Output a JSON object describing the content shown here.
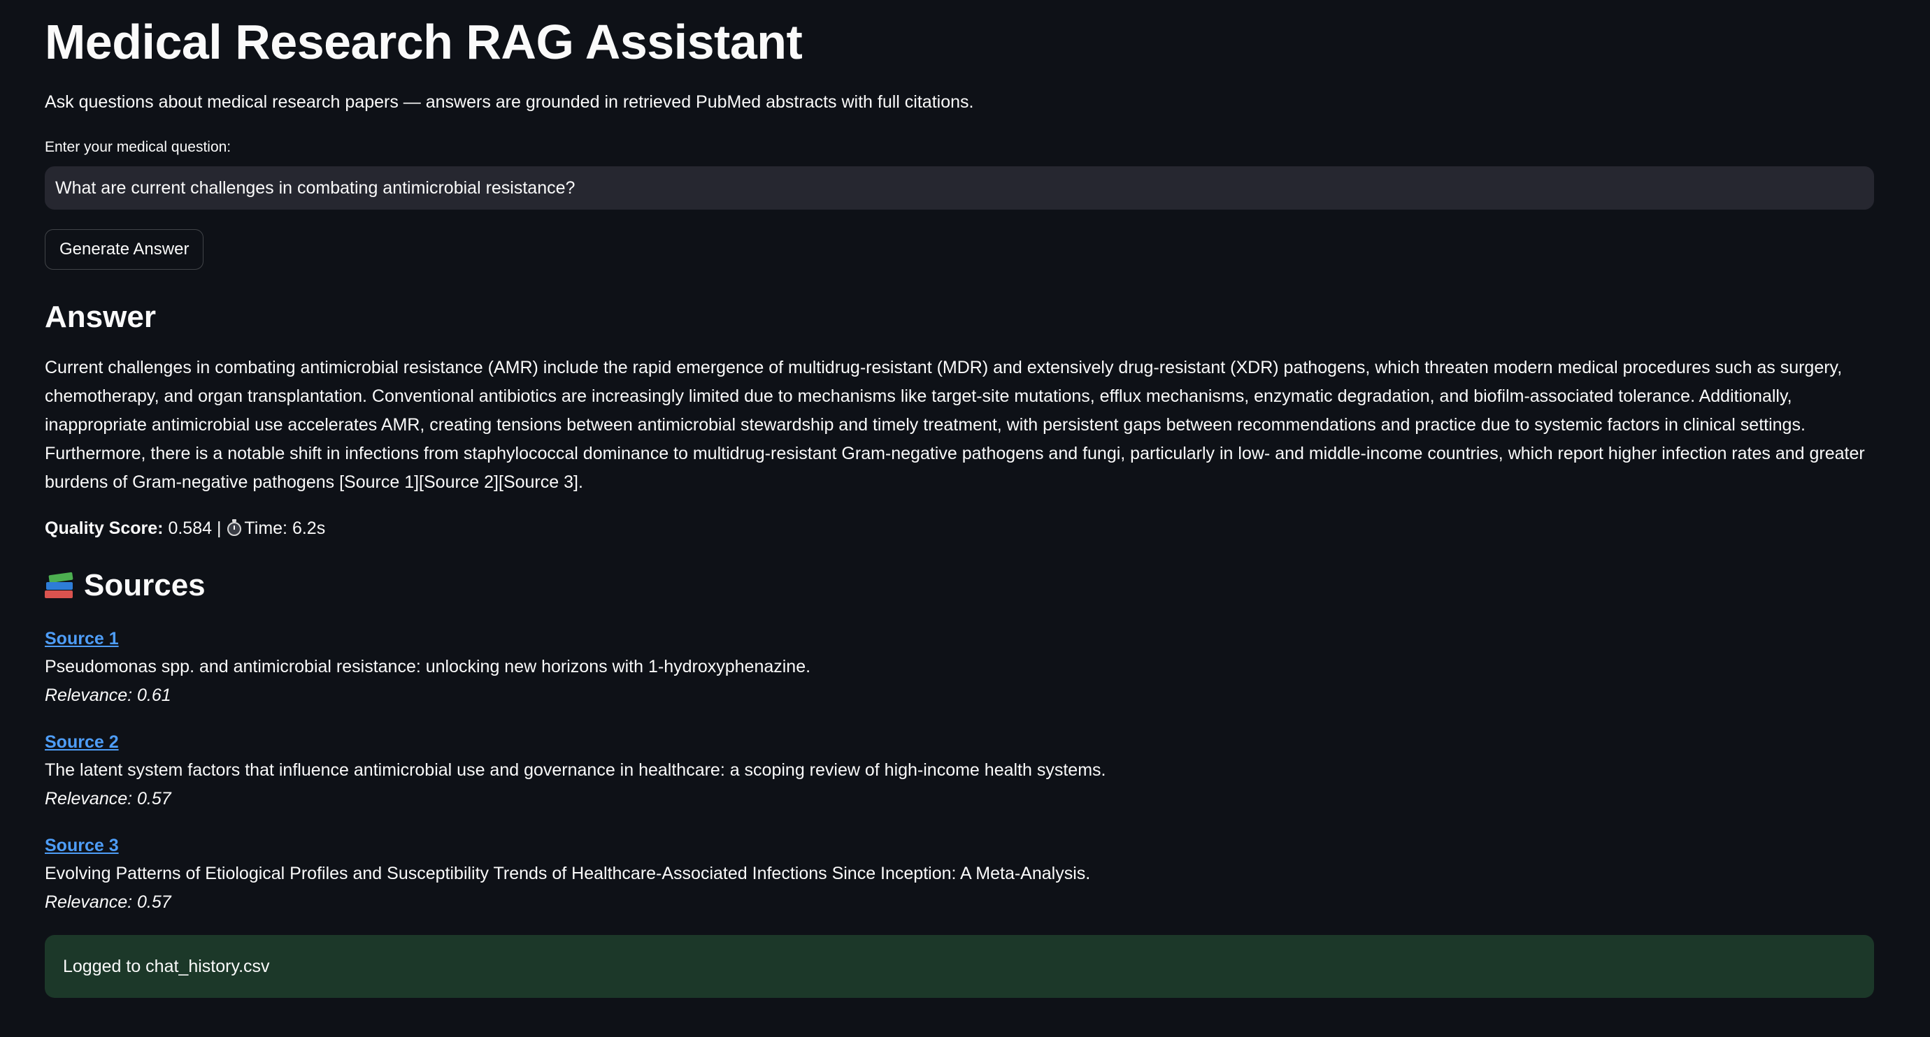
{
  "app": {
    "title": "Medical Research RAG Assistant",
    "subtitle": "Ask questions about medical research papers — answers are grounded in retrieved PubMed abstracts with full citations."
  },
  "query": {
    "label": "Enter your medical question:",
    "value": "What are current challenges in combating antimicrobial resistance?"
  },
  "actions": {
    "generate_label": "Generate Answer"
  },
  "answer": {
    "heading": "Answer",
    "text": "Current challenges in combating antimicrobial resistance (AMR) include the rapid emergence of multidrug-resistant (MDR) and extensively drug-resistant (XDR) pathogens, which threaten modern medical procedures such as surgery, chemotherapy, and organ transplantation. Conventional antibiotics are increasingly limited due to mechanisms like target-site mutations, efflux mechanisms, enzymatic degradation, and biofilm-associated tolerance. Additionally, inappropriate antimicrobial use accelerates AMR, creating tensions between antimicrobial stewardship and timely treatment, with persistent gaps between recommendations and practice due to systemic factors in clinical settings. Furthermore, there is a notable shift in infections from staphylococcal dominance to multidrug-resistant Gram-negative pathogens and fungi, particularly in low- and middle-income countries, which report higher infection rates and greater burdens of Gram-negative pathogens [Source 1][Source 2][Source 3].",
    "quality_label": "Quality Score:",
    "quality_value": "0.584",
    "separator": "|",
    "time_text": "Time: 6.2s",
    "timer_icon": "stopwatch-icon"
  },
  "sources": {
    "heading": "Sources",
    "icon": "books-icon",
    "items": [
      {
        "link": "Source 1",
        "title": "Pseudomonas spp. and antimicrobial resistance: unlocking new horizons with 1-hydroxyphenazine.",
        "relevance": "Relevance: 0.61"
      },
      {
        "link": "Source 2",
        "title": "The latent system factors that influence antimicrobial use and governance in healthcare: a scoping review of high-income health systems.",
        "relevance": "Relevance: 0.57"
      },
      {
        "link": "Source 3",
        "title": "Evolving Patterns of Etiological Profiles and Susceptibility Trends of Healthcare-Associated Infections Since Inception: A Meta-Analysis.",
        "relevance": "Relevance: 0.57"
      }
    ]
  },
  "status": {
    "message": "Logged to chat_history.csv"
  },
  "colors": {
    "background": "#0e1117",
    "input_background": "#262730",
    "link": "#4e9df7",
    "success_background": "#1c3829"
  }
}
